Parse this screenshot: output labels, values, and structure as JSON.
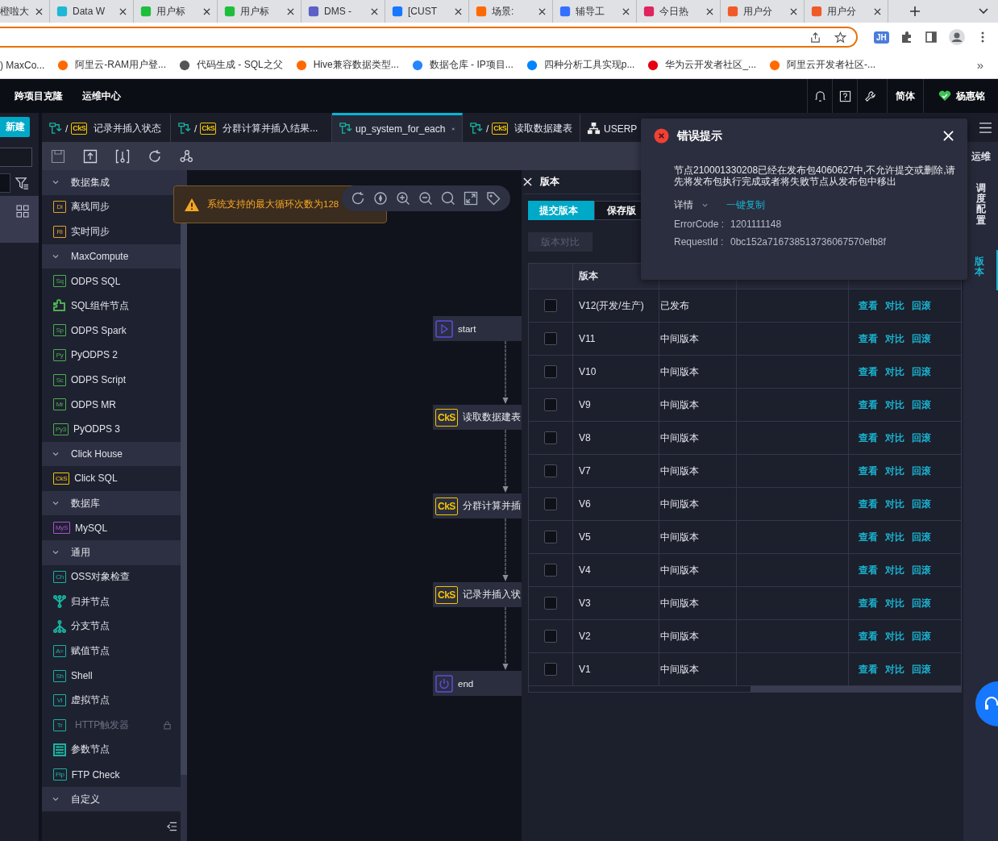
{
  "browser": {
    "tabs": [
      {
        "title": "橙啦大"
      },
      {
        "title": "Data W",
        "color": "#1fb7d5"
      },
      {
        "title": "用户标",
        "color": "#1dbf3a"
      },
      {
        "title": "用户标",
        "color": "#1dbf3a"
      },
      {
        "title": "DMS -",
        "color": "#5b5fc7"
      },
      {
        "title": "[CUST",
        "color": "#1677ff"
      },
      {
        "title": "场景:",
        "color": "#ff6a00"
      },
      {
        "title": "辅导工",
        "color": "#3370ff"
      },
      {
        "title": "今日热",
        "color": "#e0245e"
      },
      {
        "title": "用户分",
        "color": "#f05a28"
      },
      {
        "title": "用户分",
        "color": "#f05a28"
      }
    ],
    "profile": "JH",
    "bookmarks": [
      {
        "label": ") MaxCo..."
      },
      {
        "label": "阿里云-RAM用户登...",
        "color": "#ff6a00"
      },
      {
        "label": "代码生成 - SQL之父",
        "color": "#555555"
      },
      {
        "label": "Hive兼容数据类型...",
        "color": "#ff6a00"
      },
      {
        "label": "数据仓库 - IP项目...",
        "color": "#2684ff"
      },
      {
        "label": "四种分析工具实现p...",
        "color": "#0084ff"
      },
      {
        "label": "华为云开发者社区_...",
        "color": "#e60012"
      },
      {
        "label": "阿里云开发者社区-...",
        "color": "#ff6a00"
      }
    ],
    "more": "»"
  },
  "header": {
    "nav": [
      "跨项目克隆",
      "运维中心"
    ],
    "language": "简体",
    "user": "杨惠铭"
  },
  "new_button": "新建",
  "editor_tabs": [
    {
      "kind": "node",
      "prefix": "/",
      "badge": "CkS",
      "label": "记录并插入状态",
      "selected": false
    },
    {
      "kind": "node",
      "prefix": "/",
      "badge": "CkS",
      "label": "分群计算并插入结果...",
      "selected": false
    },
    {
      "kind": "flow",
      "label": "up_system_for_each",
      "selected": true
    },
    {
      "kind": "node",
      "prefix": "/",
      "badge": "CkS",
      "label": "读取数据建表",
      "selected": false
    },
    {
      "kind": "table",
      "label": "USERP",
      "selected": false
    }
  ],
  "sidebar": {
    "groups": [
      {
        "title": "数据集成",
        "expanded": true,
        "items": [
          {
            "kind": "badge",
            "badge": "Di",
            "label": "离线同步",
            "color": "#e5a323",
            "disabled": false
          },
          {
            "kind": "badge",
            "badge": "Ri",
            "label": "实时同步",
            "color": "#e5a323",
            "disabled": false
          }
        ]
      },
      {
        "title": "MaxCompute",
        "expanded": true,
        "items": [
          {
            "kind": "badge",
            "badge": "Sq",
            "label": "ODPS SQL",
            "color": "#4caf50",
            "disabled": false
          },
          {
            "kind": "puzzle",
            "label": "SQL组件节点",
            "color": "#4caf50",
            "disabled": false
          },
          {
            "kind": "badge",
            "badge": "Sp",
            "label": "ODPS Spark",
            "color": "#4caf50",
            "disabled": false
          },
          {
            "kind": "badge",
            "badge": "Py",
            "label": "PyODPS 2",
            "color": "#4caf50",
            "disabled": false
          },
          {
            "kind": "badge",
            "badge": "Sc",
            "label": "ODPS Script",
            "color": "#4caf50",
            "disabled": false
          },
          {
            "kind": "badge",
            "badge": "Mr",
            "label": "ODPS MR",
            "color": "#4caf50",
            "disabled": false
          },
          {
            "kind": "badge",
            "badge": "Py3",
            "label": "PyODPS 3",
            "color": "#4caf50",
            "disabled": false
          }
        ]
      },
      {
        "title": "Click House",
        "expanded": true,
        "items": [
          {
            "kind": "badge",
            "badge": "CkS",
            "label": "Click SQL",
            "color": "#f5c400",
            "disabled": false
          }
        ]
      },
      {
        "title": "数据库",
        "expanded": true,
        "items": [
          {
            "kind": "badge",
            "badge": "MyS",
            "label": "MySQL",
            "color": "#b04fd0",
            "disabled": false
          }
        ]
      },
      {
        "title": "通用",
        "expanded": true,
        "items": [
          {
            "kind": "badge",
            "badge": "Ch",
            "label": "OSS对象检查",
            "color": "#19b3a0",
            "disabled": false
          },
          {
            "kind": "merge",
            "label": "归并节点",
            "color": "#19b3a0",
            "disabled": false
          },
          {
            "kind": "branch",
            "label": "分支节点",
            "color": "#19b3a0",
            "disabled": false
          },
          {
            "kind": "badge",
            "badge": "A=",
            "label": "赋值节点",
            "color": "#19b3a0",
            "disabled": false
          },
          {
            "kind": "badge",
            "badge": "Sh",
            "label": "Shell",
            "color": "#19b3a0",
            "disabled": false
          },
          {
            "kind": "badge",
            "badge": "Vi",
            "label": "虚拟节点",
            "color": "#19b3a0",
            "disabled": false
          },
          {
            "kind": "badge",
            "badge": "Tr",
            "label": "HTTP触发器",
            "color": "#19b3a0",
            "disabled": true
          },
          {
            "kind": "sliders",
            "label": "参数节点",
            "color": "#19b3a0",
            "disabled": false
          },
          {
            "kind": "badge",
            "badge": "Ftp",
            "label": "FTP Check",
            "color": "#19b3a0",
            "disabled": false
          }
        ]
      },
      {
        "title": "自定义",
        "expanded": true
      }
    ]
  },
  "warning": "系统支持的最大循环次数为128",
  "flow": {
    "nodes": [
      {
        "kind": "start",
        "label": "start"
      },
      {
        "kind": "clickhouse",
        "badge": "CkS",
        "label": "读取数据建表"
      },
      {
        "kind": "clickhouse",
        "badge": "CkS",
        "label": "分群计算并插"
      },
      {
        "kind": "clickhouse",
        "badge": "CkS",
        "label": "记录并插入状"
      },
      {
        "kind": "end",
        "label": "end"
      }
    ]
  },
  "version_panel": {
    "title": "版本",
    "segments": [
      {
        "label": "提交版本",
        "selected": true
      },
      {
        "label": "保存版",
        "selected": false
      }
    ],
    "compare_button": "版本对比",
    "columns": [
      "版本"
    ],
    "rows": [
      {
        "checked": false,
        "version": "V12(开发/生产)",
        "status": "已发布",
        "actions": [
          "查看",
          "对比",
          "回滚"
        ]
      },
      {
        "checked": false,
        "version": "V11",
        "status": "中间版本",
        "actions": [
          "查看",
          "对比",
          "回滚"
        ]
      },
      {
        "checked": false,
        "version": "V10",
        "status": "中间版本",
        "actions": [
          "查看",
          "对比",
          "回滚"
        ]
      },
      {
        "checked": false,
        "version": "V9",
        "status": "中间版本",
        "actions": [
          "查看",
          "对比",
          "回滚"
        ]
      },
      {
        "checked": false,
        "version": "V8",
        "status": "中间版本",
        "actions": [
          "查看",
          "对比",
          "回滚"
        ]
      },
      {
        "checked": false,
        "version": "V7",
        "status": "中间版本",
        "actions": [
          "查看",
          "对比",
          "回滚"
        ]
      },
      {
        "checked": false,
        "version": "V6",
        "status": "中间版本",
        "actions": [
          "查看",
          "对比",
          "回滚"
        ]
      },
      {
        "checked": false,
        "version": "V5",
        "status": "中间版本",
        "actions": [
          "查看",
          "对比",
          "回滚"
        ]
      },
      {
        "checked": false,
        "version": "V4",
        "status": "中间版本",
        "actions": [
          "查看",
          "对比",
          "回滚"
        ]
      },
      {
        "checked": false,
        "version": "V3",
        "status": "中间版本",
        "actions": [
          "查看",
          "对比",
          "回滚"
        ]
      },
      {
        "checked": false,
        "version": "V2",
        "status": "中间版本",
        "actions": [
          "查看",
          "对比",
          "回滚"
        ]
      },
      {
        "checked": false,
        "version": "V1",
        "status": "中间版本",
        "actions": [
          "查看",
          "对比",
          "回滚"
        ]
      }
    ]
  },
  "right_strip": [
    {
      "label": "运维",
      "selected": false,
      "kind": "link"
    },
    {
      "label": "调度配置",
      "selected": false,
      "kind": "vertical"
    },
    {
      "label": "版本",
      "selected": true,
      "kind": "vertical"
    }
  ],
  "error_dialog": {
    "title": "错误提示",
    "message": "节点210001330208已经在发布包4060627中,不允许提交或删除,请先将发布包执行完成或者将失败节点从发布包中移出",
    "details": "详情",
    "copy": "一键复制",
    "fields": [
      {
        "label": "ErrorCode :",
        "value": "1201111148"
      },
      {
        "label": "RequestId :",
        "value": "0bc152a716738513736067570efb8f"
      }
    ]
  }
}
